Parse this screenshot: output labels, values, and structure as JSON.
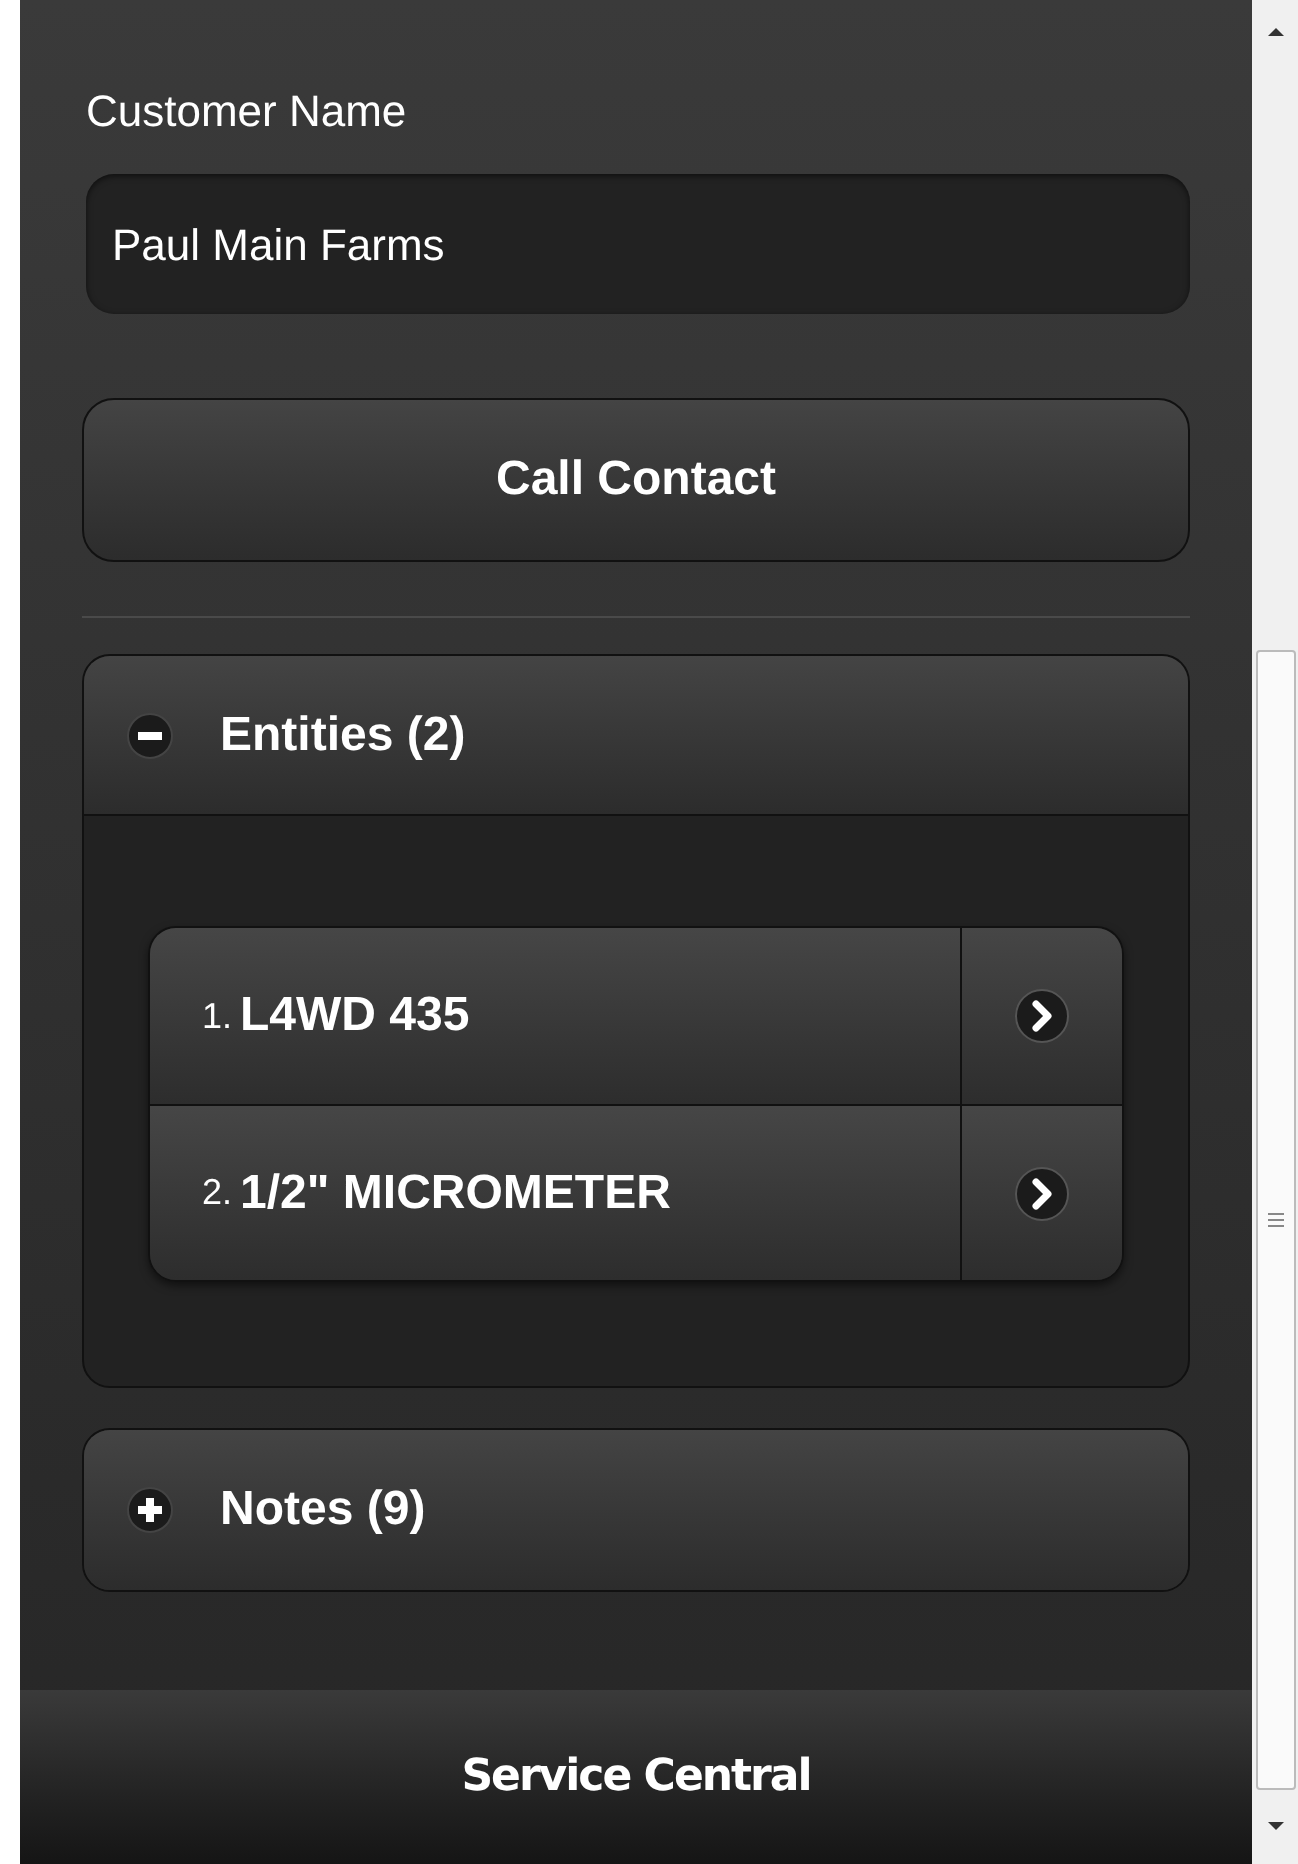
{
  "customer_name": {
    "label": "Customer Name",
    "value": "Paul Main Farms"
  },
  "call_button": {
    "label": "Call Contact"
  },
  "sections": [
    {
      "title": "Entities (2)",
      "expanded": true,
      "items": [
        {
          "number": "1.",
          "label": "L4WD 435"
        },
        {
          "number": "2.",
          "label": "1/2\" MICROMETER"
        }
      ]
    },
    {
      "title": "Notes (9)",
      "expanded": false
    }
  ],
  "footer": {
    "title": "Service Central"
  }
}
